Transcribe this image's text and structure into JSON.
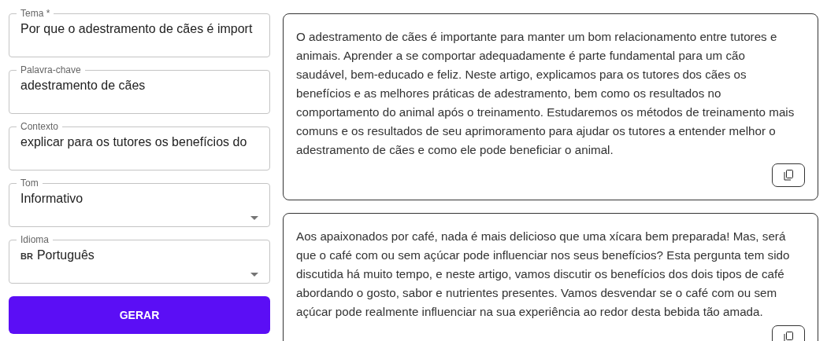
{
  "form": {
    "fields": [
      {
        "kind": "text",
        "label": "Tema *",
        "value": "Por que o adestramento de cães é import"
      },
      {
        "kind": "text",
        "label": "Palavra-chave",
        "value": "adestramento de cães"
      },
      {
        "kind": "text",
        "label": "Contexto",
        "value": "explicar para os tutores os benefícios do"
      },
      {
        "kind": "select",
        "label": "Tom",
        "value": "Informativo"
      },
      {
        "kind": "select",
        "label": "Idioma",
        "prefix": "BR",
        "value": "Português"
      }
    ],
    "button": "GERAR"
  },
  "results": [
    {
      "text": "O adestramento de cães é importante para manter um bom relacionamento entre tutores e animais. Aprender a se comportar adequadamente é parte fundamental para um cão saudável, bem-educado e feliz. Neste artigo, explicamos para os tutores dos cães os benefícios e as melhores práticas de adestramento, bem como os resultados no comportamento do animal após o treinamento. Estudaremos os métodos de treinamento mais comuns e os resultados de seu aprimoramento para ajudar os tutores a entender melhor o adestramento de cães e como ele pode beneficiar o animal."
    },
    {
      "text": "Aos apaixonados por café, nada é mais delicioso que uma xícara bem preparada! Mas, será que o café com ou sem açúcar pode influenciar nos seus benefícios? Esta pergunta tem sido discutida há muito tempo, e neste artigo, vamos discutir os benefícios dos dois tipos de café abordando o gosto, sabor e nutrientes presentes. Vamos desvendar se o café com ou sem açúcar pode realmente influenciar na sua experiência ao redor desta bebida tão amada."
    }
  ]
}
